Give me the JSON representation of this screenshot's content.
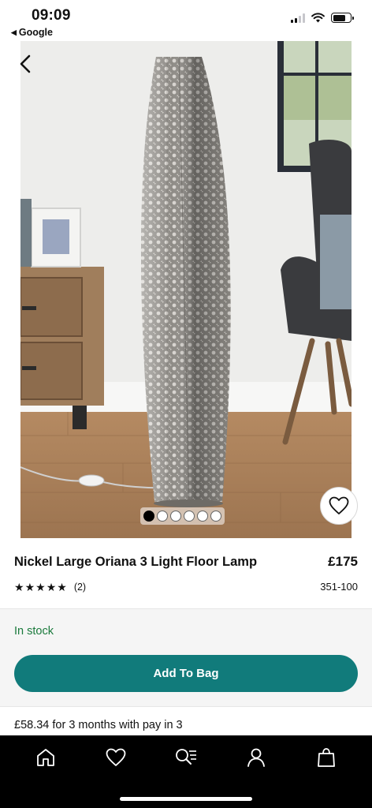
{
  "status_bar": {
    "time": "09:09",
    "back_app_label": "Google"
  },
  "hero": {
    "image_count": 6,
    "active_index": 0
  },
  "product": {
    "title": "Nickel Large Oriana 3 Light Floor Lamp",
    "price": "£175",
    "rating": 5,
    "review_count": "(2)",
    "item_code": "351-100",
    "stock_status": "In stock",
    "add_to_bag_label": "Add To Bag",
    "pay_in_3_text": "£58.34 for 3 months with pay in 3"
  },
  "nav": {
    "items": [
      "home-icon",
      "heart-icon",
      "search-list-icon",
      "account-icon",
      "bag-icon"
    ]
  },
  "colors": {
    "accent": "#117b7b",
    "stock_green": "#1a7a3c",
    "nav_bg": "#000000"
  }
}
